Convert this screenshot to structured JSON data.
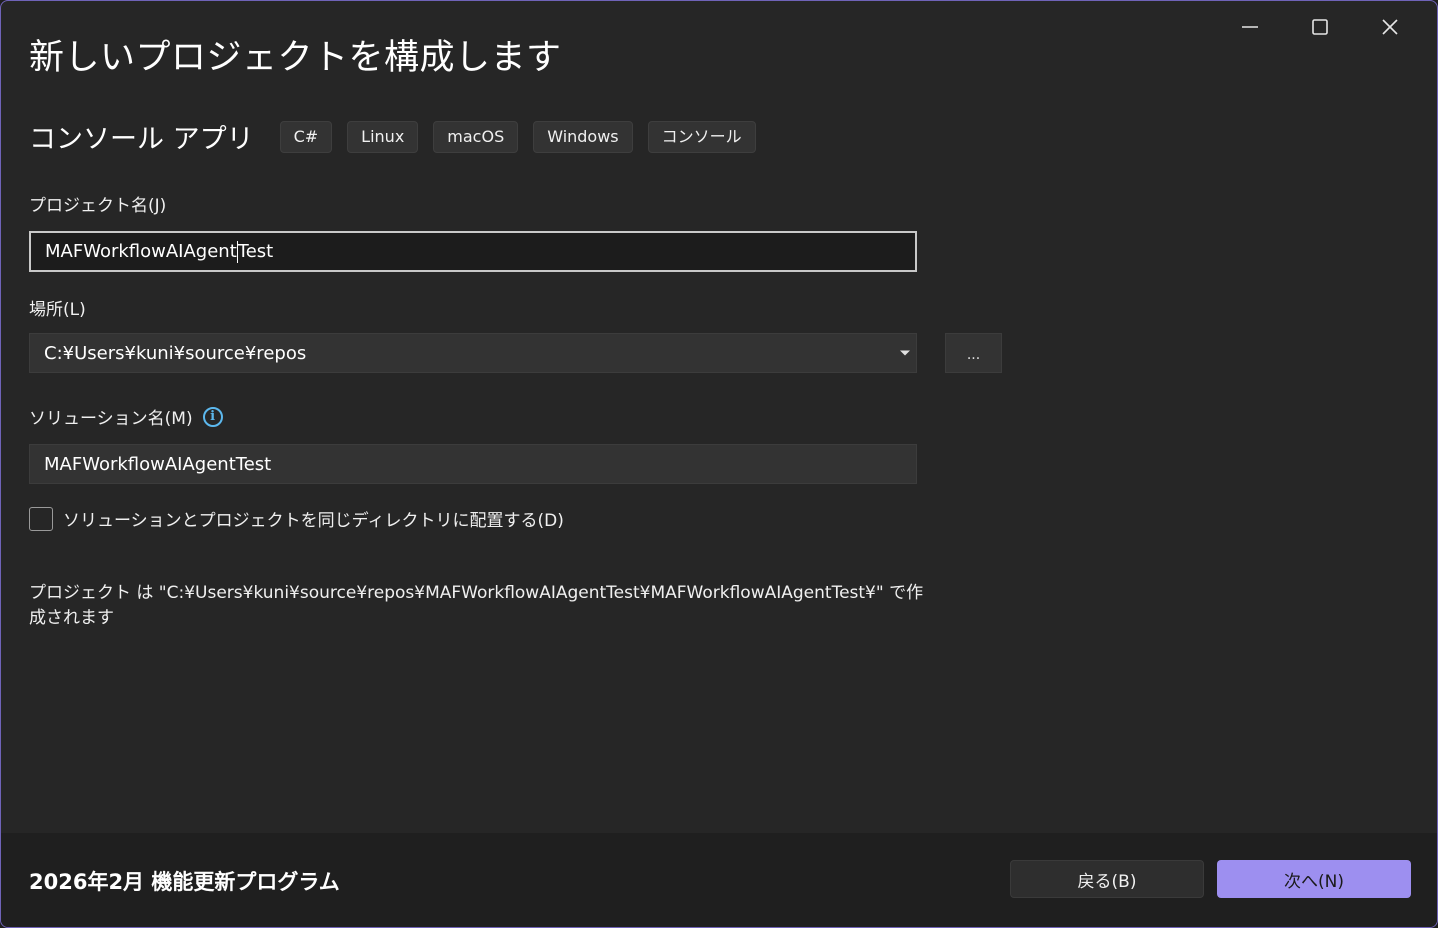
{
  "window": {
    "title": "新しいプロジェクトを構成します",
    "controls": {
      "minimize_icon": "minimize-icon",
      "maximize_icon": "maximize-icon",
      "close_icon": "close-icon"
    }
  },
  "template": {
    "name": "コンソール アプリ",
    "tags": [
      "C#",
      "Linux",
      "macOS",
      "Windows",
      "コンソール"
    ]
  },
  "project_name": {
    "label": "プロジェクト名(J)",
    "value_before_caret": "MAFWorkflowAIAgent",
    "value_after_caret": "Test"
  },
  "location": {
    "label": "場所(L)",
    "value": "C:¥Users¥kuni¥source¥repos",
    "browse_label": "..."
  },
  "solution_name": {
    "label": "ソリューション名(M)",
    "info_icon": "info-icon",
    "info_glyph": "i",
    "value": "MAFWorkflowAIAgentTest"
  },
  "same_directory": {
    "label": "ソリューションとプロジェクトを同じディレクトリに配置する(D)",
    "checked": false
  },
  "path_note": {
    "line1": "プロジェクト は \"C:¥Users¥kuni¥source¥repos¥MAFWorkflowAIAgentTest¥MAFWorkflowAIAgentTest¥\" で作",
    "line2": "成されます"
  },
  "footer": {
    "version_text": "2026年2月 機能更新プログラム",
    "back_label": "戻る(B)",
    "next_label": "次へ(N)"
  },
  "colors": {
    "accent": "#9d8ff0",
    "window_border": "#6f63b8",
    "background": "#262626",
    "info": "#5cb8ee"
  }
}
